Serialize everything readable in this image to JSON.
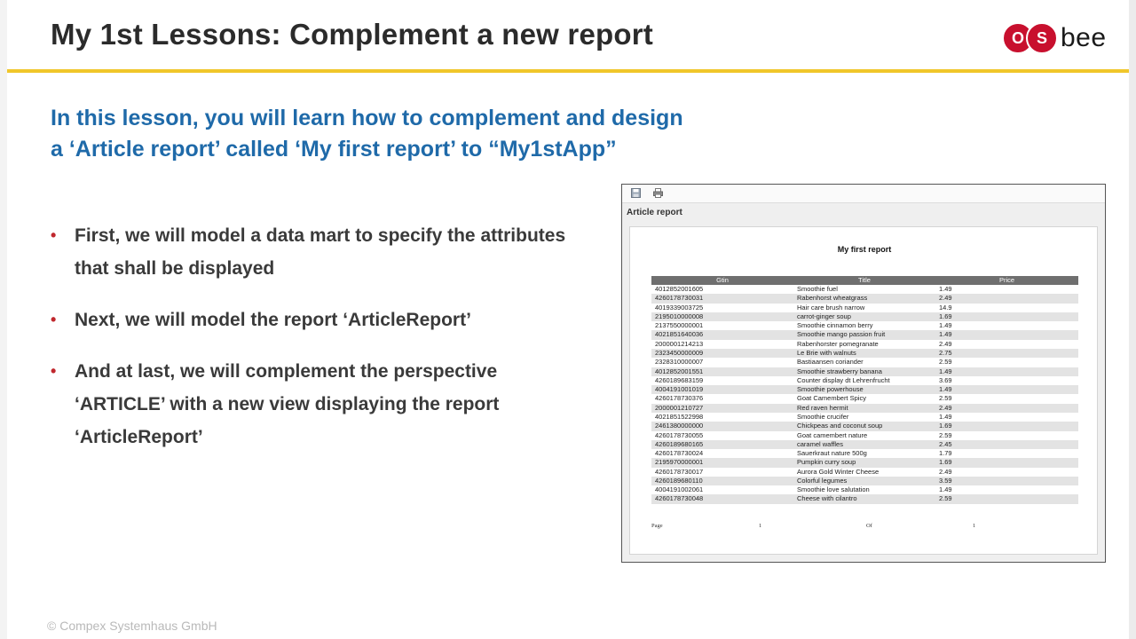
{
  "colors": {
    "accent_yellow": "#f0c62a",
    "intro_blue": "#1f6aa9",
    "bullet_red": "#c0272d",
    "logo_red": "#c8102e"
  },
  "header": {
    "title": "My 1st Lessons: Complement a new report",
    "logo": {
      "o": "O",
      "s": "S",
      "text": "bee"
    }
  },
  "intro": {
    "line1": "In this lesson, you will learn how to complement and design",
    "line2": "a ‘Article report’ called ‘My first report’ to “My1stApp”"
  },
  "bullets": [
    "First, we will model a data mart to specify the attributes that shall be displayed",
    "Next, we will model the report ‘ArticleReport’",
    "And at last, we will complement the perspective ‘ARTICLE’ with a new view displaying the report ‘ArticleReport’"
  ],
  "report": {
    "toolbar_icons": [
      "save-icon",
      "print-icon"
    ],
    "name": "Article report",
    "heading": "My first report",
    "columns": [
      "Gtin",
      "Title",
      "Price"
    ],
    "rows": [
      [
        "4012852001605",
        "Smoothie fuel",
        "1.49"
      ],
      [
        "4260178730031",
        "Rabenhorst wheatgrass",
        "2.49"
      ],
      [
        "4019339003725",
        "Hair care brush narrow",
        "14.9"
      ],
      [
        "2195010000008",
        "carrot-ginger soup",
        "1.69"
      ],
      [
        "2137550000001",
        "Smoothie cinnamon berry",
        "1.49"
      ],
      [
        "4021851640036",
        "Smoothie mango passion fruit",
        "1.49"
      ],
      [
        "2000001214213",
        "Rabenhorster pomegranate",
        "2.49"
      ],
      [
        "2323450000009",
        "Le Brie with walnuts",
        "2.75"
      ],
      [
        "2328310000007",
        "Bastiaansen coriander",
        "2.59"
      ],
      [
        "4012852001551",
        "Smoothie strawberry banana",
        "1.49"
      ],
      [
        "4260189683159",
        "Counter display dt Lehrenfrucht",
        "3.69"
      ],
      [
        "4004191001019",
        "Smoothie powerhouse",
        "1.49"
      ],
      [
        "4260178730376",
        "Goat Camembert Spicy",
        "2.59"
      ],
      [
        "2000001210727",
        "Red raven hermit",
        "2.49"
      ],
      [
        "4021851522998",
        "Smoothie crucifer",
        "1.49"
      ],
      [
        "2461380000000",
        "Chickpeas and coconut soup",
        "1.69"
      ],
      [
        "4260178730055",
        "Goat camembert nature",
        "2.59"
      ],
      [
        "4260189680165",
        "caramel waffles",
        "2.45"
      ],
      [
        "4260178730024",
        "Sauerkraut nature 500g",
        "1.79"
      ],
      [
        "2195970000001",
        "Pumpkin curry soup",
        "1.69"
      ],
      [
        "4260178730017",
        "Aurora Gold Winter Cheese",
        "2.49"
      ],
      [
        "4260189680110",
        "Colorful legumes",
        "3.59"
      ],
      [
        "4004191002061",
        "Smoothie love salutation",
        "1.49"
      ],
      [
        "4260178730048",
        "Cheese with cilantro",
        "2.59"
      ]
    ],
    "footer": {
      "page_label": "Page",
      "page_number": "1",
      "of_label": "Of",
      "total_pages": "1"
    }
  },
  "copyright": "©  Compex Systemhaus GmbH"
}
